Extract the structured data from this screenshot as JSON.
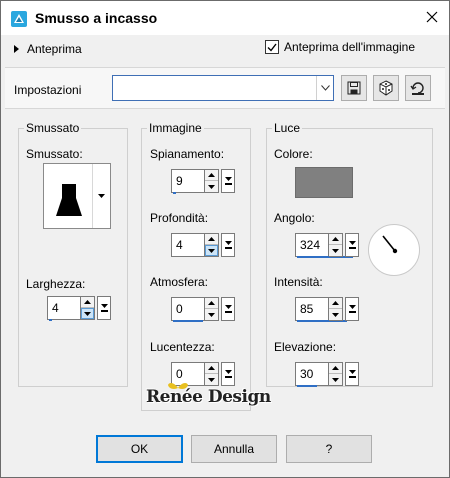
{
  "window": {
    "title": "Smusso a incasso"
  },
  "preview": {
    "toggle_label": "Anteprima",
    "image_preview_label": "Anteprima dell'immagine",
    "image_preview_checked": true
  },
  "toolbar": {
    "settings_label": "Impostazioni",
    "preset_value": ""
  },
  "bevel": {
    "group_label": "Smussato",
    "picker_label": "Smussato:",
    "width_label": "Larghezza:",
    "width_value": "4"
  },
  "image": {
    "group_label": "Immagine",
    "smoothness_label": "Spianamento:",
    "smoothness_value": "9",
    "depth_label": "Profondità:",
    "depth_value": "4",
    "ambience_label": "Atmosfera:",
    "ambience_value": "0",
    "shininess_label": "Lucentezza:",
    "shininess_value": "0"
  },
  "light": {
    "group_label": "Luce",
    "color_label": "Colore:",
    "color": "#808080",
    "angle_label": "Angolo:",
    "angle_value": "324",
    "intensity_label": "Intensità:",
    "intensity_value": "85",
    "elevation_label": "Elevazione:",
    "elevation_value": "30"
  },
  "watermark": "Renée Design",
  "buttons": {
    "ok": "OK",
    "cancel": "Annulla",
    "help": "?"
  },
  "colors": {
    "accent": "#0078d7",
    "indicator": "#2f6fc5"
  }
}
